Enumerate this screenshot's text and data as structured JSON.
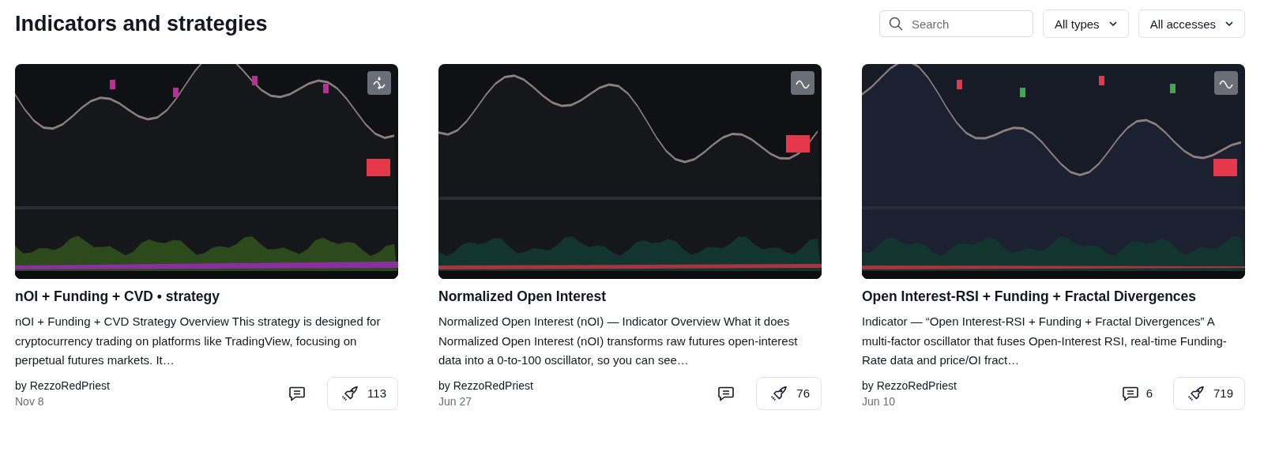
{
  "title": "Indicators and strategies",
  "search": {
    "placeholder": "Search"
  },
  "filters": [
    {
      "label": "All types"
    },
    {
      "label": "All accesses"
    }
  ],
  "cards": [
    {
      "kind": "strategy",
      "title": "nOI + Funding + CVD • strategy",
      "description": "nOI + Funding + CVD Strategy Overview This strategy is designed for cryptocurrency trading on platforms like TradingView, focusing on perpetual futures markets. It…",
      "author": "by RezzoRedPriest",
      "date": "Nov 8",
      "boosts": "113"
    },
    {
      "kind": "indicator",
      "title": "Normalized Open Interest",
      "description": "Normalized Open Interest (nOI) — Indicator Overview What it does Normalized Open Interest (nOI) transforms raw futures open-interest data into a 0-to-100 oscillator, so you can see…",
      "author": "by RezzoRedPriest",
      "date": "Jun 27",
      "boosts": "76"
    },
    {
      "kind": "indicator",
      "title": "Open Interest-RSI + Funding + Fractal Divergences",
      "description": "Indicator — “Open Interest-RSI + Funding + Fractal Divergences” A multi-factor oscillator that fuses Open-Interest RSI, real-time Funding-Rate data and price/OI fract…",
      "author": "by RezzoRedPriest",
      "date": "Jun 10",
      "comments": "6",
      "boosts": "719"
    }
  ]
}
